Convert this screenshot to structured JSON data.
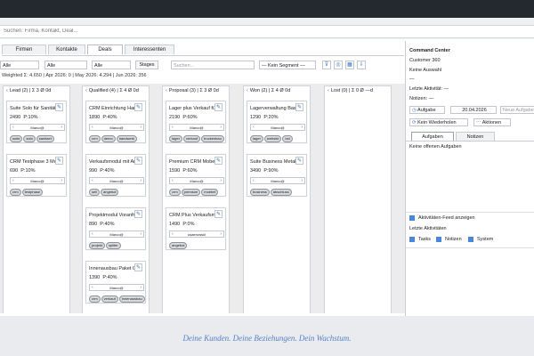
{
  "search": {
    "placeholder": "Suchen: Firma, Kontakt, Deal..."
  },
  "tabs": [
    {
      "label": "Firmen"
    },
    {
      "label": "Kontakte"
    },
    {
      "label": "Deals"
    },
    {
      "label": "Interessenten"
    }
  ],
  "filters": {
    "f1": "Alle",
    "f2": "Alle",
    "f3": "Alle",
    "stages": "Stages",
    "search_placeholder": "Suchen...",
    "segment": "— Kein Segment —"
  },
  "summary": "Weighted Σ: 4.650 | Apr 2026: 0 | May 2026: 4.294 | Jun 2026: 356",
  "columns": [
    {
      "name": "Lead",
      "count": "(2)",
      "sigma": "Σ 3",
      "avg": "Ø 0d",
      "cards": [
        {
          "title": "Suite Solo für Sanität",
          "value": "2490",
          "prob": "P:10%",
          "owner": "Marco@",
          "tags": [
            "suite",
            "solo",
            "sanitaet"
          ]
        },
        {
          "title": "CRM Testphase 3 Mo",
          "value": "690",
          "prob": "P:10%",
          "owner": "Marco@",
          "tags": [
            "crm",
            "testphase"
          ]
        }
      ]
    },
    {
      "name": "Qualified",
      "count": "(4)",
      "sigma": "Σ 4",
      "avg": "Ø 0d",
      "cards": [
        {
          "title": "CRM Einrichtung Han",
          "value": "1890",
          "prob": "P:40%",
          "owner": "Marco@",
          "tags": [
            "crm",
            "demo",
            "handwerk"
          ]
        },
        {
          "title": "Verkaufsmodul mit Ani",
          "value": "990",
          "prob": "P:40%",
          "owner": "Marco@",
          "tags": [
            "sell",
            "angebot"
          ]
        },
        {
          "title": "Projektmodul Voranfra",
          "value": "890",
          "prob": "P:40%",
          "owner": "Marco@",
          "tags": [
            "projekt",
            "spliter"
          ]
        },
        {
          "title": "Innenausbau Paket Cl",
          "value": "1390",
          "prob": "P:40%",
          "owner": "Marco@",
          "tags": [
            "crm",
            "verkauf",
            "innenausbau"
          ]
        }
      ]
    },
    {
      "name": "Proposal",
      "count": "(3)",
      "sigma": "Σ 3",
      "avg": "Ø 0d",
      "cards": [
        {
          "title": "Lager plus Verkauf für",
          "value": "2190",
          "prob": "P:60%",
          "owner": "Marco@",
          "tags": [
            "lager",
            "verkauf",
            "trockenbau"
          ]
        },
        {
          "title": "Premium CRM Mobel",
          "value": "1590",
          "prob": "P:60%",
          "owner": "Marco@",
          "tags": [
            "crm",
            "premium",
            "moebel"
          ]
        },
        {
          "title": "CRM Plus Verkaufsm",
          "value": "1490",
          "prob": "P:0%",
          "owner": "usaerowski",
          "tags": [
            "angebot"
          ]
        }
      ]
    },
    {
      "name": "Won",
      "count": "(2)",
      "sigma": "Σ 4",
      "avg": "Ø 0d",
      "cards": [
        {
          "title": "Lagerverwaltung Basis",
          "value": "1290",
          "prob": "P:20%",
          "owner": "Marco@",
          "tags": [
            "lager",
            "website",
            "bsl"
          ]
        },
        {
          "title": "Suite Business Metall",
          "value": "3490",
          "prob": "P:90%",
          "owner": "Marco@",
          "tags": [
            "business",
            "abschluss"
          ]
        }
      ]
    },
    {
      "name": "Lost",
      "count": "(0)",
      "sigma": "Σ 0",
      "avg": "Ø —d",
      "cards": []
    }
  ],
  "command_center": {
    "title": "Command Center",
    "customer": "Customer 360",
    "selection": "Keine Auswahl",
    "dash": "—",
    "last_activity": "Letzte Aktivität: —",
    "notes": "Notizen: —",
    "task_btn": "Aufgabe",
    "date": "20.04.2026",
    "new_task_placeholder": "Neue Aufgabe",
    "repeat_btn": "Kein Wiederholen",
    "actions_btn": "Aktionen",
    "tab_tasks": "Aufgaben",
    "tab_notes": "Notizen",
    "no_tasks": "Keine offenen Aufgaben",
    "feed_toggle": "Aktivitäten-Feed anzeigen",
    "recent": "Letzte Aktivitäten",
    "filter_tasks": "Tasks",
    "filter_notes": "Notizen",
    "filter_system": "System"
  },
  "tagline": "Deine Kunden. Deine Beziehungen. Dein Wachstum.",
  "colors": {
    "accent": "#4a86d6",
    "topbar": "#24292f",
    "tagline": "#5680c8"
  }
}
